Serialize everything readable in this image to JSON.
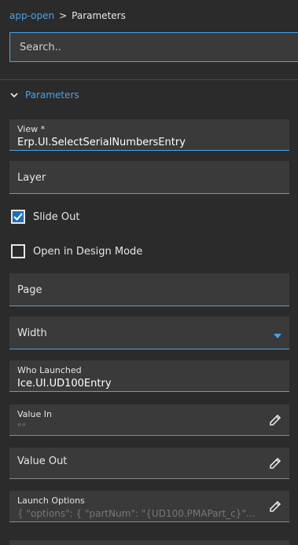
{
  "breadcrumb": {
    "parent": "app-open",
    "separator": ">",
    "current": "Parameters"
  },
  "search": {
    "placeholder": "Search.."
  },
  "section": {
    "title": "Parameters"
  },
  "fields": {
    "view": {
      "label": "View *",
      "value": "Erp.UI.SelectSerialNumbersEntry"
    },
    "layer": {
      "label": "Layer"
    },
    "slide_out": {
      "label": "Slide Out",
      "checked": true
    },
    "open_design": {
      "label": "Open in Design Mode",
      "checked": false
    },
    "page": {
      "label": "Page"
    },
    "width": {
      "label": "Width"
    },
    "who_launched": {
      "label": "Who Launched",
      "value": "Ice.UI.UD100Entry"
    },
    "value_in": {
      "label": "Value In",
      "placeholder": "\"\""
    },
    "value_out": {
      "label": "Value Out"
    },
    "launch_options": {
      "label": "Launch Options",
      "placeholder": "{  \"options\": {    \"partNum\": \"{UD100.PMAPart_c}\", ..."
    }
  },
  "colors": {
    "accent": "#4aa3e8",
    "background": "#2b2b2b",
    "field": "#3a3a3a",
    "checkbox": "#1f6fb5"
  }
}
